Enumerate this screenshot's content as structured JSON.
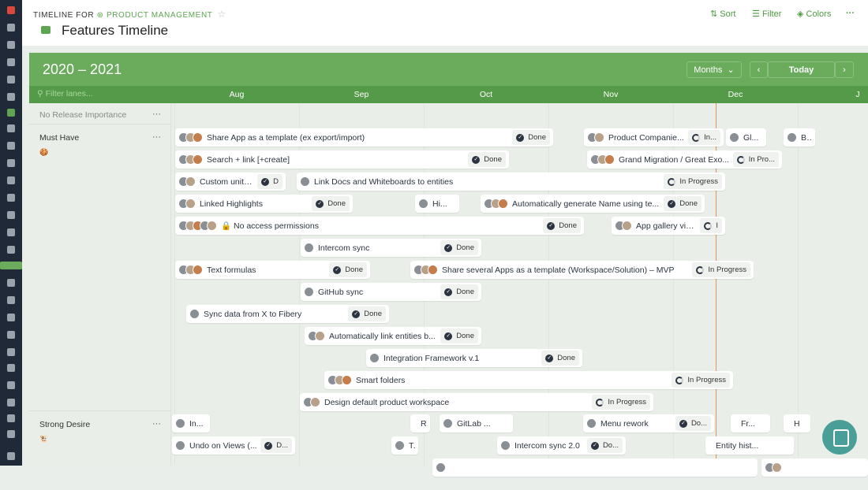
{
  "header": {
    "crumb_prefix": "TIMELINE FOR",
    "space": "PRODUCT MANAGEMENT",
    "title": "Features Timeline",
    "sort": "Sort",
    "filter": "Filter",
    "colors": "Colors",
    "more": "···"
  },
  "toolbar": {
    "years": "2020 – 2021",
    "scale": "Months",
    "today": "Today",
    "prev": "‹",
    "next": "›",
    "filter_placeholder": "Filter lanes..."
  },
  "months": [
    "Aug",
    "Sep",
    "Oct",
    "Nov",
    "Dec",
    "J"
  ],
  "colors": {
    "accent": "#6aac5c",
    "today_line": "#e0935a",
    "sidebar": "#1f2937"
  },
  "lanes": [
    {
      "label": "No Release Importance",
      "more": "···"
    },
    {
      "label": "Must Have",
      "more": "···"
    },
    {
      "label": "Strong Desire",
      "more": "···"
    }
  ],
  "cards": [
    {
      "title": "Share App as a template (ex export/import)",
      "status": "Done"
    },
    {
      "title": "Product Companie...",
      "status": "In..."
    },
    {
      "title": "Gl...",
      "status": ""
    },
    {
      "title": "B...",
      "status": ""
    },
    {
      "title": "Search + link [+create]",
      "status": "Done"
    },
    {
      "title": "Grand Migration / Great Exo...",
      "status": "In Pro..."
    },
    {
      "title": "Custom units i...",
      "status": "D"
    },
    {
      "title": "Link Docs and Whiteboards to entities",
      "status": "In Progress"
    },
    {
      "title": "Linked Highlights",
      "status": "Done"
    },
    {
      "title": "Hi...",
      "status": ""
    },
    {
      "title": "Automatically generate Name using te...",
      "status": "Done"
    },
    {
      "title": "🔒 No access permissions",
      "status": "Done"
    },
    {
      "title": "App gallery via...",
      "status": "I"
    },
    {
      "title": "Intercom sync",
      "status": "Done"
    },
    {
      "title": "Text formulas",
      "status": "Done"
    },
    {
      "title": "Share several Apps as a template (Workspace/Solution) – MVP",
      "status": "In Progress"
    },
    {
      "title": "GitHub sync",
      "status": "Done"
    },
    {
      "title": "Sync data from X to Fibery",
      "status": "Done"
    },
    {
      "title": "Automatically link entities b...",
      "status": "Done"
    },
    {
      "title": "Integration Framework v.1",
      "status": "Done"
    },
    {
      "title": "Smart folders",
      "status": "In Progress"
    },
    {
      "title": "Design default product workspace",
      "status": "In Progress"
    },
    {
      "title": "In...",
      "status": ""
    },
    {
      "title": "R",
      "status": ""
    },
    {
      "title": "GitLab ...",
      "status": ""
    },
    {
      "title": "Menu rework",
      "status": "Do..."
    },
    {
      "title": "Fr...",
      "status": ""
    },
    {
      "title": "H",
      "status": ""
    },
    {
      "title": "Undo on Views (...",
      "status": "D..."
    },
    {
      "title": "T...",
      "status": ""
    },
    {
      "title": "Intercom sync 2.0",
      "status": "Do..."
    },
    {
      "title": "Entity hist...",
      "status": ""
    },
    {
      "title": "",
      "status": ""
    },
    {
      "title": "",
      "status": ""
    }
  ]
}
